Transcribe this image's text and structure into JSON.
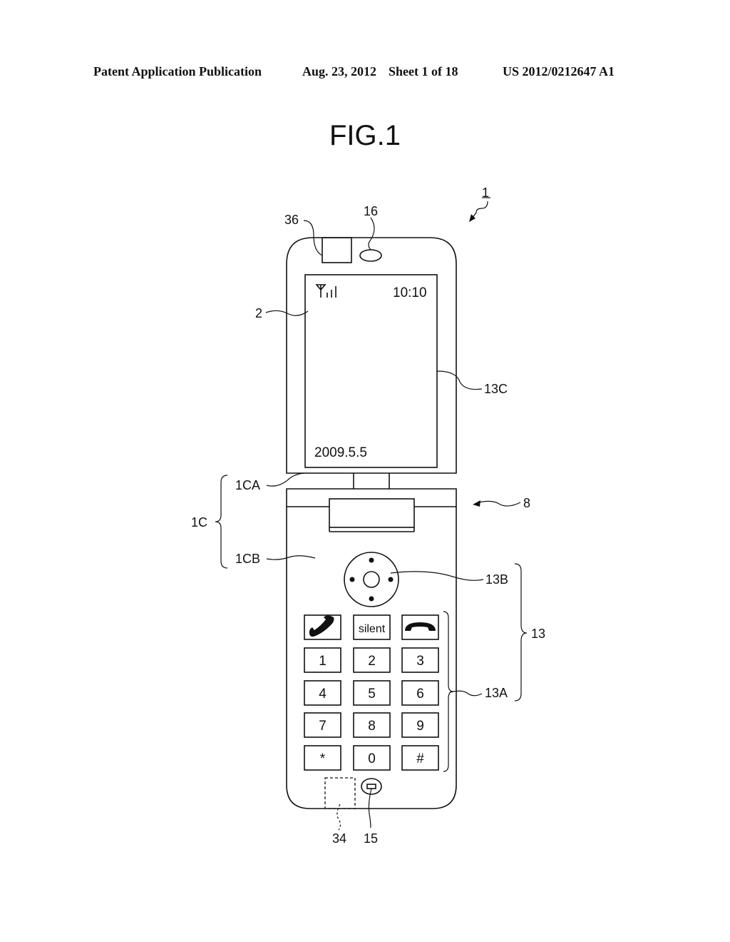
{
  "header": {
    "publication": "Patent Application Publication",
    "date": "Aug. 23, 2012",
    "sheet": "Sheet 1 of 18",
    "number": "US 2012/0212647 A1"
  },
  "figure": {
    "title": "FIG.1",
    "screen": {
      "time": "10:10",
      "date": "2009.5.5",
      "signal_icon": "antenna-signal-icon"
    },
    "keypad": {
      "function_keys": [
        {
          "icon": "call-start-icon",
          "label": ""
        },
        {
          "icon": "",
          "label": "silent"
        },
        {
          "icon": "call-end-icon",
          "label": ""
        }
      ],
      "number_keys": [
        "1",
        "2",
        "3",
        "4",
        "5",
        "6",
        "7",
        "8",
        "9",
        "*",
        "0",
        "#"
      ]
    },
    "reference_labels": {
      "device": "1",
      "camera": "36",
      "speaker": "16",
      "display": "2",
      "touch_sensor_display": "13C",
      "housing": "1C",
      "upper_housing": "1CA",
      "lower_housing": "1CB",
      "hinge": "8",
      "navigation_key": "13B",
      "operation_unit": "13",
      "keypad": "13A",
      "internal_part": "34",
      "microphone": "15"
    }
  }
}
